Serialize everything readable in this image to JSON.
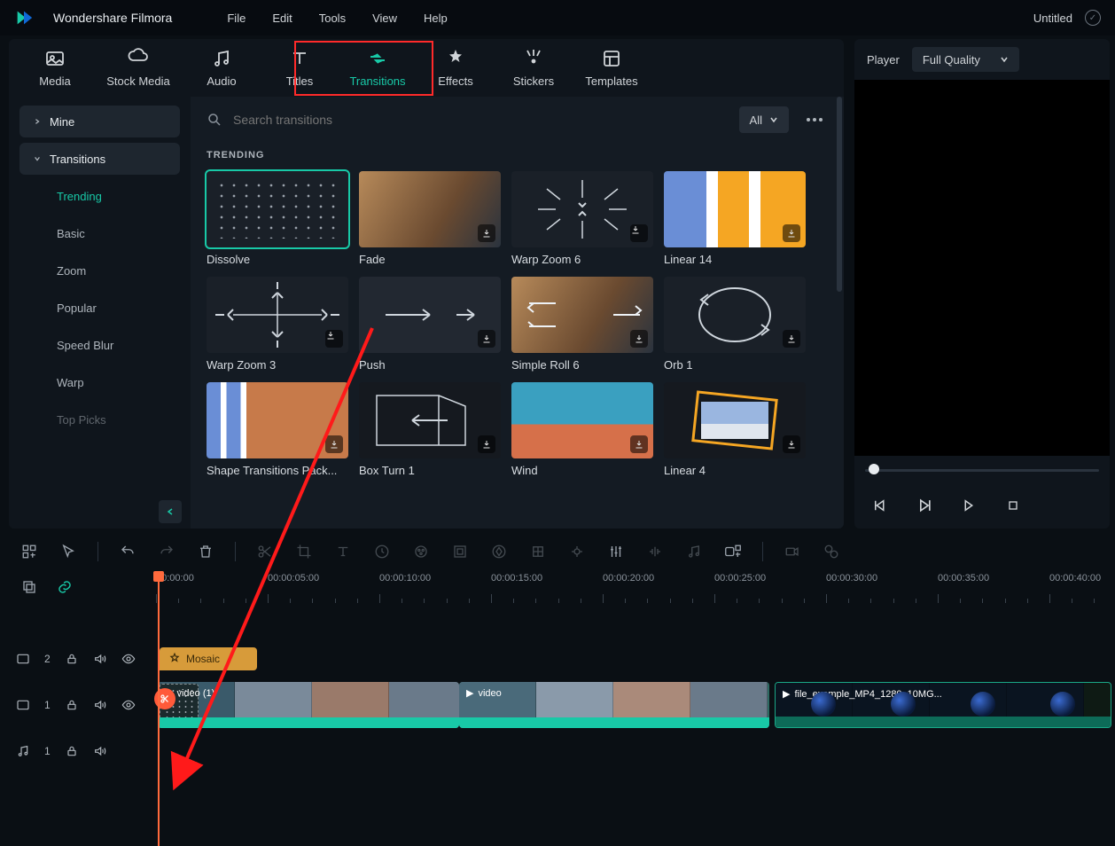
{
  "app_name": "Wondershare Filmora",
  "menu": [
    "File",
    "Edit",
    "Tools",
    "View",
    "Help"
  ],
  "project_title": "Untitled",
  "tabs": [
    {
      "id": "media",
      "label": "Media"
    },
    {
      "id": "stock",
      "label": "Stock Media"
    },
    {
      "id": "audio",
      "label": "Audio"
    },
    {
      "id": "titles",
      "label": "Titles"
    },
    {
      "id": "transitions",
      "label": "Transitions"
    },
    {
      "id": "effects",
      "label": "Effects"
    },
    {
      "id": "stickers",
      "label": "Stickers"
    },
    {
      "id": "templates",
      "label": "Templates"
    }
  ],
  "sidebar": {
    "mine": "Mine",
    "transitions": "Transitions",
    "items": [
      "Trending",
      "Basic",
      "Zoom",
      "Popular",
      "Speed Blur",
      "Warp",
      "Top Picks"
    ]
  },
  "search": {
    "placeholder": "Search transitions"
  },
  "filter": {
    "label": "All"
  },
  "section_heading": "TRENDING",
  "cards": [
    {
      "label": "Dissolve"
    },
    {
      "label": "Fade"
    },
    {
      "label": "Warp Zoom 6"
    },
    {
      "label": "Linear 14"
    },
    {
      "label": "Warp Zoom 3"
    },
    {
      "label": "Push"
    },
    {
      "label": "Simple Roll 6"
    },
    {
      "label": "Orb 1"
    },
    {
      "label": "Shape Transitions Pack..."
    },
    {
      "label": "Box Turn 1"
    },
    {
      "label": "Wind"
    },
    {
      "label": "Linear 4"
    }
  ],
  "preview": {
    "title": "Player",
    "quality": "Full Quality"
  },
  "ruler": [
    "00:00:00",
    "00:00:05:00",
    "00:00:10:00",
    "00:00:15:00",
    "00:00:20:00",
    "00:00:25:00",
    "00:00:30:00",
    "00:00:35:00",
    "00:00:40:00"
  ],
  "tracks": {
    "fx": {
      "label": "2"
    },
    "v1": {
      "label": "1"
    },
    "a1": {
      "label": "1"
    }
  },
  "clips": {
    "effect_name": "Mosaic",
    "video1_sublabel": "video (1)",
    "video2_label": "video",
    "video3_label": "file_example_MP4_1280_10MG..."
  }
}
